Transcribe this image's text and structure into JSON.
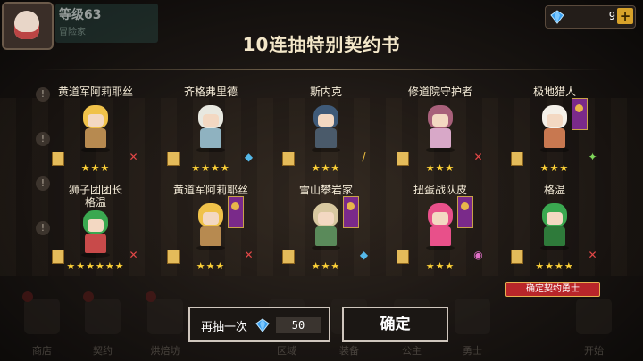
{
  "header": {
    "level": "等级63",
    "sub": "冒险家"
  },
  "currency": {
    "gem_count": "9",
    "plus": "+"
  },
  "title": "10连抽特别契约书",
  "heroes": [
    {
      "name": "黄道军阿莉耶丝",
      "stars": "★★★",
      "class": "sword",
      "hair": "#f0c24a",
      "outfit": "#b78a50",
      "flag": false
    },
    {
      "name": "齐格弗里德",
      "stars": "★★★★",
      "class": "axe",
      "hair": "#e8e8e0",
      "outfit": "#8fb2c0",
      "flag": false
    },
    {
      "name": "斯内克",
      "stars": "★★★",
      "class": "bow",
      "hair": "#3f5a78",
      "outfit": "#4a5a6a",
      "flag": false
    },
    {
      "name": "修道院守护者",
      "stars": "★★★",
      "class": "sword",
      "hair": "#a8607a",
      "outfit": "#d8a8c8",
      "flag": false
    },
    {
      "name": "极地猎人",
      "stars": "★★★",
      "class": "shield",
      "hair": "#f4f0e8",
      "outfit": "#c87850",
      "flag": true
    },
    {
      "name": "狮子团团长\n格温",
      "stars": "★★★★★★",
      "class": "sword",
      "hair": "#3aa850",
      "outfit": "#c84a4a",
      "flag": false
    },
    {
      "name": "黄道军阿莉耶丝",
      "stars": "★★★",
      "class": "sword",
      "hair": "#f0c24a",
      "outfit": "#b78a50",
      "flag": true
    },
    {
      "name": "雪山攀岩家",
      "stars": "★★★",
      "class": "axe",
      "hair": "#d8c8a0",
      "outfit": "#5a8a5a",
      "flag": true
    },
    {
      "name": "扭蛋战队皮",
      "stars": "★★★",
      "class": "staff",
      "hair": "#e8508a",
      "outfit": "#e8508a",
      "flag": true
    },
    {
      "name": "格温",
      "stars": "★★★★",
      "class": "sword",
      "hair": "#3aa850",
      "outfit": "#2e7a3a",
      "flag": false
    }
  ],
  "confirm_ribbon": "确定契约勇士",
  "buttons": {
    "again_label": "再抽一次",
    "again_cost": "50",
    "confirm_label": "确定"
  },
  "nav": [
    {
      "label": "商店"
    },
    {
      "label": "契约"
    },
    {
      "label": "烘焙坊"
    },
    {
      "label": "区域"
    },
    {
      "label": "装备"
    },
    {
      "label": "公主"
    },
    {
      "label": "勇士"
    },
    {
      "label": "开始"
    }
  ]
}
